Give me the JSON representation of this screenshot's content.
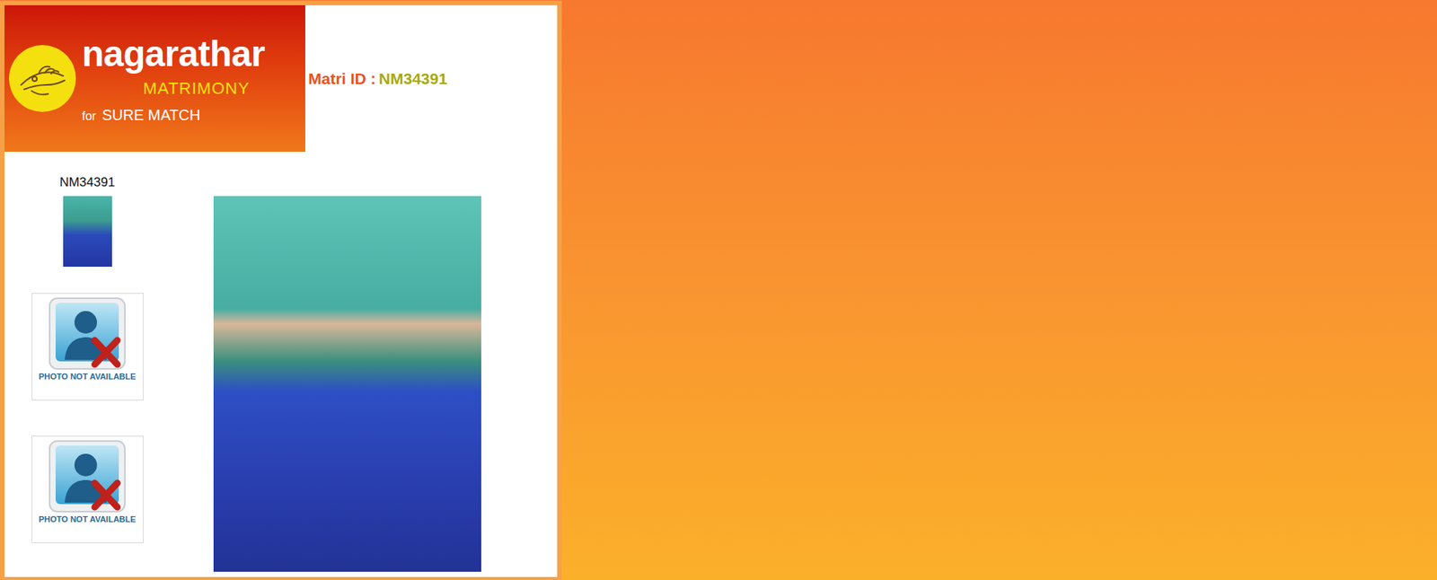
{
  "header": {
    "logo": {
      "name": "nagarathar",
      "tagline": "MATRIMONY",
      "for": "for",
      "slogan": "SURE MATCH"
    },
    "matri_id": {
      "label": "Matri ID :",
      "value": "NM34391"
    }
  },
  "profile": {
    "id_label": "NM34391",
    "photos": [
      {
        "kind": "photo"
      },
      {
        "kind": "placeholder",
        "text": "PHOTO NOT AVAILABLE"
      },
      {
        "kind": "placeholder",
        "text": "PHOTO NOT AVAILABLE"
      }
    ]
  }
}
